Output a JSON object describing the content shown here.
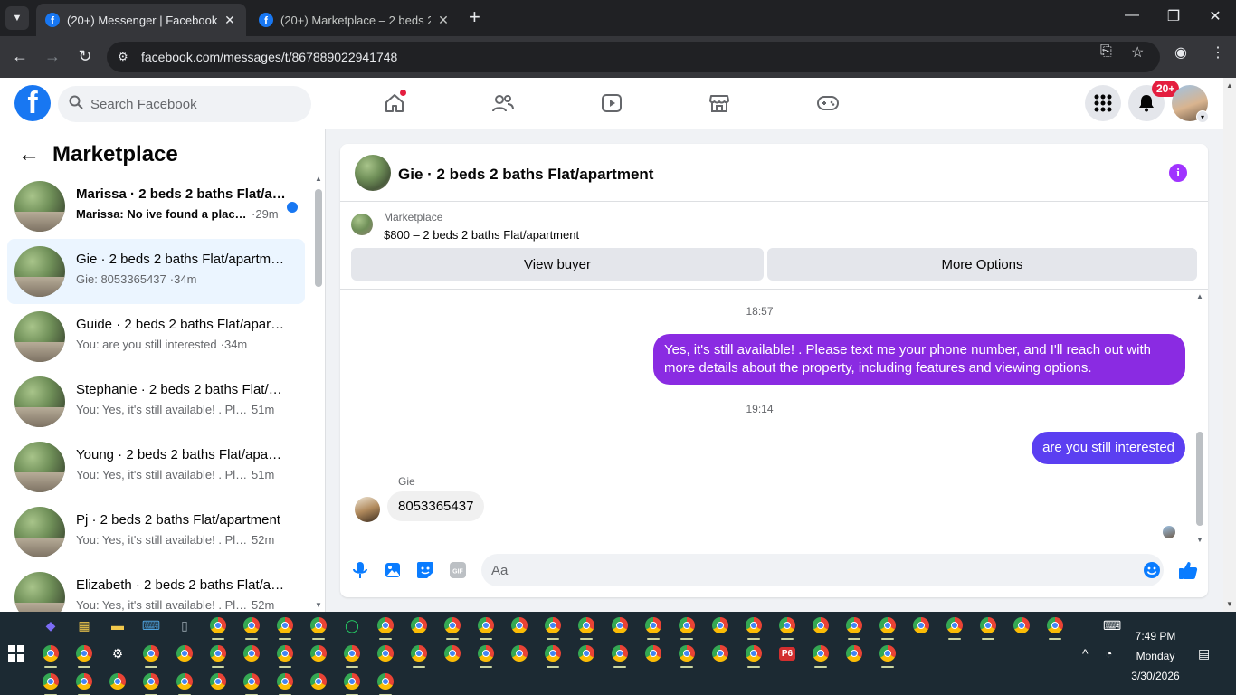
{
  "browser": {
    "tabs": [
      {
        "title": "(20+) Messenger | Facebook",
        "active": true
      },
      {
        "title": "(20+) Marketplace – 2 beds 2 b",
        "active": false
      }
    ],
    "url": "facebook.com/messages/t/867889022941748"
  },
  "header": {
    "search_placeholder": "Search Facebook",
    "notifications_badge": "20+",
    "nav_icons": [
      "home-icon",
      "friends-icon",
      "video-icon",
      "marketplace-icon",
      "gaming-icon"
    ]
  },
  "sidebar": {
    "title": "Marketplace",
    "conversations": [
      {
        "name": "Marissa · 2 beds 2 baths Flat/apartment",
        "preview": "Marissa: No ive found a place ...",
        "time": "29m",
        "unread": true
      },
      {
        "name": "Gie · 2 beds 2 baths Flat/apartment",
        "preview": "Gie: 8053365437",
        "time": "34m",
        "selected": true
      },
      {
        "name": "Guide · 2 beds 2 baths Flat/apartment",
        "preview": "You: are you still interested",
        "time": "34m"
      },
      {
        "name": "Stephanie · 2 beds 2 baths Flat/apartment",
        "preview": "You: Yes, it's still available! . Pleas...",
        "time": "51m"
      },
      {
        "name": "Young · 2 beds 2 baths Flat/apartment",
        "preview": "You: Yes, it's still available! . Pleas...",
        "time": "51m"
      },
      {
        "name": "Pj · 2 beds 2 baths Flat/apartment",
        "preview": "You: Yes, it's still available! . Pleas...",
        "time": "52m"
      },
      {
        "name": "Elizabeth · 2 beds 2 baths Flat/apartment",
        "preview": "You: Yes, it's still available! . Pleas...",
        "time": "52m"
      }
    ]
  },
  "chat": {
    "title": "Gie · 2 beds 2 baths Flat/apartment",
    "marketplace_label": "Marketplace",
    "listing": "$800 – 2 beds 2 baths Flat/apartment",
    "view_buyer": "View buyer",
    "more_options": "More Options",
    "timestamp1": "18:57",
    "message1": "Yes, it's still available! . Please text me your phone number, and I'll reach out with more details about the property, including features and viewing options.",
    "timestamp2": "19:14",
    "message2": "are you still interested",
    "sender": "Gie",
    "reply": "8053365437",
    "composer_placeholder": "Aa"
  },
  "taskbar": {
    "time": "7:49 PM",
    "day": "Monday",
    "date": "3/30/2026",
    "p6_label": "P6"
  },
  "colors": {
    "fb_blue": "#1877f2",
    "bubble_purple": "#8a2be2",
    "bubble_indigo": "#5b3ff1",
    "badge_red": "#e41e3f"
  }
}
